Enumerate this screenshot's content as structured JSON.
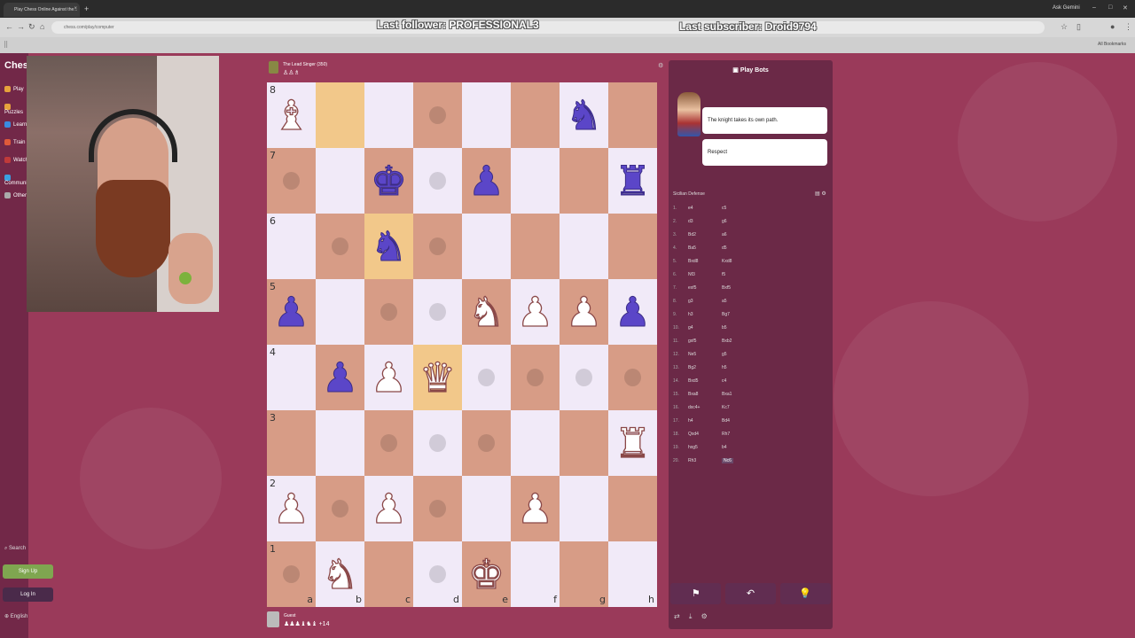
{
  "browser": {
    "tab_title": "Play Chess Online Against the...",
    "tab_close": "×",
    "new_tab": "+",
    "url": "chess.com/play/computer",
    "ask": "Ask Gemini",
    "all_bookmarks": "All Bookmarks"
  },
  "overlay": {
    "follower": "Last follower: PROFESSIONAL3",
    "subscriber": "Last subscriber: Droid9794"
  },
  "sidebar": {
    "logo": "Chess",
    "items": [
      {
        "label": "Play",
        "color": "#e6a23c"
      },
      {
        "label": "Puzzles",
        "color": "#e6a23c"
      },
      {
        "label": "Learn",
        "color": "#3a8be0"
      },
      {
        "label": "Train",
        "color": "#e05a3a"
      },
      {
        "label": "Watch",
        "color": "#c03a3a"
      },
      {
        "label": "Community",
        "color": "#3aa0e0"
      },
      {
        "label": "Other",
        "color": "#aaaaaa"
      }
    ],
    "search": "Search",
    "signup": "Sign Up",
    "login": "Log In",
    "language": "English"
  },
  "top_player": {
    "name": "The Lead Singer (350)",
    "captured": "♙♙♗"
  },
  "bottom_player": {
    "name": "Guest",
    "captured": "♟♟♟♝♞♝ +14"
  },
  "board": {
    "ranks": [
      "8",
      "7",
      "6",
      "5",
      "4",
      "3",
      "2",
      "1"
    ],
    "files": [
      "a",
      "b",
      "c",
      "d",
      "e",
      "f",
      "g",
      "h"
    ],
    "highlights": [
      "b8",
      "c6",
      "d4"
    ],
    "dots": [
      "d8",
      "a7",
      "d7",
      "b6",
      "d6",
      "c5",
      "d5",
      "e4",
      "f4",
      "g4",
      "h4",
      "c3",
      "d3",
      "e3",
      "b2",
      "d2",
      "a1",
      "d1"
    ],
    "pieces": [
      {
        "sq": "a8",
        "glyph": "♝",
        "color": "w"
      },
      {
        "sq": "g8",
        "glyph": "♞",
        "color": "b"
      },
      {
        "sq": "c7",
        "glyph": "♚",
        "color": "b"
      },
      {
        "sq": "e7",
        "glyph": "♟",
        "color": "b"
      },
      {
        "sq": "h7",
        "glyph": "♜",
        "color": "b"
      },
      {
        "sq": "c6",
        "glyph": "♞",
        "color": "b"
      },
      {
        "sq": "a5",
        "glyph": "♟",
        "color": "b"
      },
      {
        "sq": "e5",
        "glyph": "♞",
        "color": "w"
      },
      {
        "sq": "f5",
        "glyph": "♟",
        "color": "w"
      },
      {
        "sq": "g5",
        "glyph": "♟",
        "color": "w"
      },
      {
        "sq": "h5",
        "glyph": "♟",
        "color": "b"
      },
      {
        "sq": "b4",
        "glyph": "♟",
        "color": "b"
      },
      {
        "sq": "c4",
        "glyph": "♟",
        "color": "w"
      },
      {
        "sq": "d4",
        "glyph": "♛",
        "color": "w"
      },
      {
        "sq": "h3",
        "glyph": "♜",
        "color": "w"
      },
      {
        "sq": "a2",
        "glyph": "♟",
        "color": "w"
      },
      {
        "sq": "c2",
        "glyph": "♟",
        "color": "w"
      },
      {
        "sq": "f2",
        "glyph": "♟",
        "color": "w"
      },
      {
        "sq": "b1",
        "glyph": "♞",
        "color": "w"
      },
      {
        "sq": "e1",
        "glyph": "♚",
        "color": "w"
      }
    ]
  },
  "panel": {
    "title": "Play Bots",
    "bubble1": "The knight takes its own path.",
    "bubble2": "Respect",
    "opening": "Sicilian Defense",
    "icons": "▤ ⚙",
    "moves": [
      {
        "n": "1.",
        "w": "e4",
        "b": "c5"
      },
      {
        "n": "2.",
        "w": "d3",
        "b": "g6"
      },
      {
        "n": "3.",
        "w": "Bd2",
        "b": "a6"
      },
      {
        "n": "4.",
        "w": "Ba5",
        "b": "d5"
      },
      {
        "n": "5.",
        "w": "Bxd8",
        "b": "Kxd8"
      },
      {
        "n": "6.",
        "w": "Nf3",
        "b": "f5"
      },
      {
        "n": "7.",
        "w": "exf5",
        "b": "Bxf5"
      },
      {
        "n": "8.",
        "w": "g3",
        "b": "a5"
      },
      {
        "n": "9.",
        "w": "h3",
        "b": "Bg7"
      },
      {
        "n": "10.",
        "w": "g4",
        "b": "b5"
      },
      {
        "n": "11.",
        "w": "gxf5",
        "b": "Bxb2"
      },
      {
        "n": "12.",
        "w": "Ne5",
        "b": "g5"
      },
      {
        "n": "13.",
        "w": "Bg2",
        "b": "h5"
      },
      {
        "n": "14.",
        "w": "Bxd5",
        "b": "c4"
      },
      {
        "n": "15.",
        "w": "Bxa8",
        "b": "Bxa1"
      },
      {
        "n": "16.",
        "w": "dxc4+",
        "b": "Kc7"
      },
      {
        "n": "17.",
        "w": "h4",
        "b": "Bd4"
      },
      {
        "n": "18.",
        "w": "Qxd4",
        "b": "Rh7"
      },
      {
        "n": "19.",
        "w": "hxg5",
        "b": "b4"
      },
      {
        "n": "20.",
        "w": "Rh3",
        "b": "Nc6"
      }
    ],
    "controls": [
      "⚑",
      "↶",
      "💡"
    ],
    "bottom_icons": "⇄ ⤓ ⚙"
  }
}
